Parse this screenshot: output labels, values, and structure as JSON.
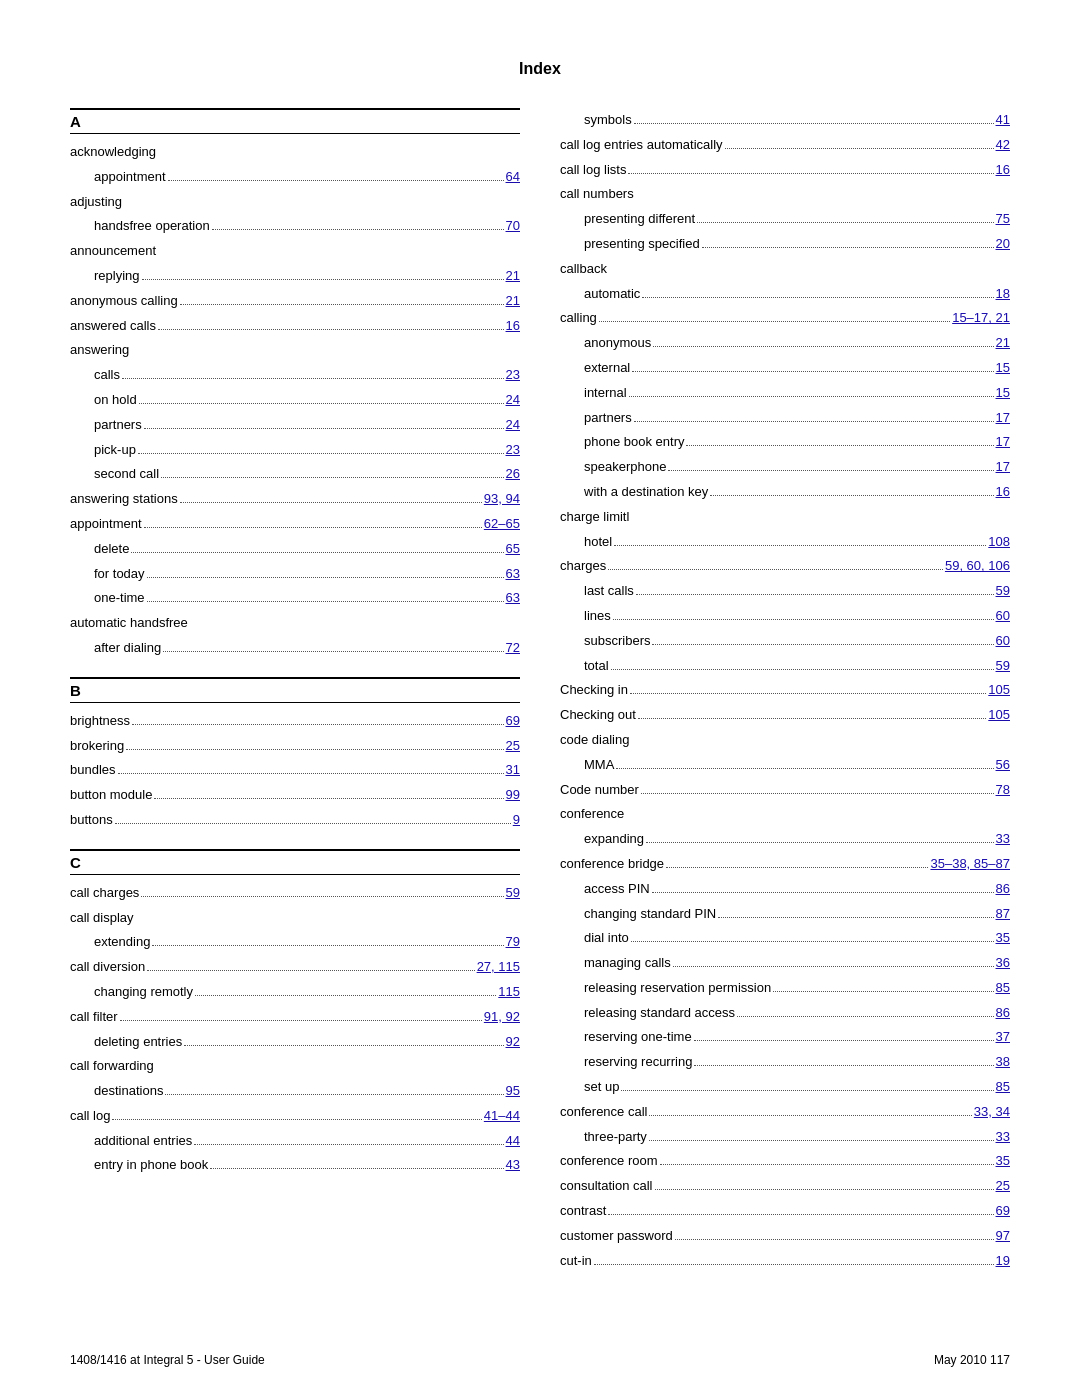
{
  "title": "Index",
  "footer": {
    "left": "1408/1416 at Integral 5 - User Guide",
    "right": "May 2010    117"
  },
  "left_column": {
    "sections": [
      {
        "header": "A",
        "entries": [
          {
            "term": "acknowledging",
            "dots": true,
            "page": ""
          },
          {
            "term": "appointment",
            "indent": 1,
            "dots": true,
            "page": "64"
          },
          {
            "term": "adjusting",
            "dots": true,
            "page": ""
          },
          {
            "term": "handsfree operation",
            "indent": 1,
            "dots": true,
            "page": "70"
          },
          {
            "term": "announcement",
            "dots": true,
            "page": ""
          },
          {
            "term": "replying",
            "indent": 1,
            "dots": true,
            "page": "21"
          },
          {
            "term": "anonymous calling",
            "dots": true,
            "page": "21"
          },
          {
            "term": "answered calls",
            "dots": true,
            "page": "16"
          },
          {
            "term": "answering",
            "dots": true,
            "page": ""
          },
          {
            "term": "calls",
            "indent": 1,
            "dots": true,
            "page": "23"
          },
          {
            "term": "on hold",
            "indent": 1,
            "dots": true,
            "page": "24"
          },
          {
            "term": "partners",
            "indent": 1,
            "dots": true,
            "page": "24"
          },
          {
            "term": "pick-up",
            "indent": 1,
            "dots": true,
            "page": "23"
          },
          {
            "term": "second call",
            "indent": 1,
            "dots": true,
            "page": "26"
          },
          {
            "term": "answering stations",
            "dots": true,
            "page": "93, 94"
          },
          {
            "term": "appointment",
            "dots": true,
            "page": "62–65"
          },
          {
            "term": "delete",
            "indent": 1,
            "dots": true,
            "page": "65"
          },
          {
            "term": "for today",
            "indent": 1,
            "dots": true,
            "page": "63"
          },
          {
            "term": "one-time",
            "indent": 1,
            "dots": true,
            "page": "63"
          },
          {
            "term": "automatic handsfree",
            "dots": true,
            "page": ""
          },
          {
            "term": "after dialing",
            "indent": 1,
            "dots": true,
            "page": "72"
          }
        ]
      },
      {
        "header": "B",
        "entries": [
          {
            "term": "brightness",
            "dots": true,
            "page": "69"
          },
          {
            "term": "brokering",
            "dots": true,
            "page": "25"
          },
          {
            "term": "bundles",
            "dots": true,
            "page": "31"
          },
          {
            "term": "button module",
            "dots": true,
            "page": "99"
          },
          {
            "term": "buttons",
            "dots": true,
            "page": "9"
          }
        ]
      },
      {
        "header": "C",
        "entries": [
          {
            "term": "call charges",
            "dots": true,
            "page": "59"
          },
          {
            "term": "call display",
            "dots": true,
            "page": ""
          },
          {
            "term": "extending",
            "indent": 1,
            "dots": true,
            "page": "79"
          },
          {
            "term": "call diversion",
            "dots": true,
            "page": "27, 115"
          },
          {
            "term": "changing remotly",
            "indent": 1,
            "dots": true,
            "page": "115"
          },
          {
            "term": "call filter",
            "dots": true,
            "page": "91, 92"
          },
          {
            "term": "deleting entries",
            "indent": 1,
            "dots": true,
            "page": "92"
          },
          {
            "term": "call forwarding",
            "dots": true,
            "page": ""
          },
          {
            "term": "destinations",
            "indent": 1,
            "dots": true,
            "page": "95"
          },
          {
            "term": "call log",
            "dots": true,
            "page": "41–44"
          },
          {
            "term": "additional entries",
            "indent": 1,
            "dots": true,
            "page": "44"
          },
          {
            "term": "entry in phone book",
            "indent": 1,
            "dots": true,
            "page": "43"
          }
        ]
      }
    ]
  },
  "right_column": {
    "entries_top": [
      {
        "term": "symbols",
        "indent": 1,
        "dots": true,
        "page": "41"
      },
      {
        "term": "call log entries automatically",
        "dots": true,
        "page": "42"
      },
      {
        "term": "call log lists",
        "dots": true,
        "page": "16"
      },
      {
        "term": "call numbers",
        "dots": true,
        "page": ""
      },
      {
        "term": "presenting different",
        "indent": 1,
        "dots": true,
        "page": "75"
      },
      {
        "term": "presenting specified",
        "indent": 1,
        "dots": true,
        "page": "20"
      },
      {
        "term": "callback",
        "dots": true,
        "page": ""
      },
      {
        "term": "automatic",
        "indent": 1,
        "dots": true,
        "page": "18"
      },
      {
        "term": "calling",
        "dots": true,
        "page": "15–17, 21"
      },
      {
        "term": "anonymous",
        "indent": 1,
        "dots": true,
        "page": "21"
      },
      {
        "term": "external",
        "indent": 1,
        "dots": true,
        "page": "15"
      },
      {
        "term": "internal",
        "indent": 1,
        "dots": true,
        "page": "15"
      },
      {
        "term": "partners",
        "indent": 1,
        "dots": true,
        "page": "17"
      },
      {
        "term": "phone book entry",
        "indent": 1,
        "dots": true,
        "page": "17"
      },
      {
        "term": "speakerphone",
        "indent": 1,
        "dots": true,
        "page": "17"
      },
      {
        "term": "with a destination key",
        "indent": 1,
        "dots": true,
        "page": "16"
      },
      {
        "term": "charge limitl",
        "dots": true,
        "page": ""
      },
      {
        "term": "hotel",
        "indent": 1,
        "dots": true,
        "page": "108"
      },
      {
        "term": "charges",
        "dots": true,
        "page": "59, 60, 106"
      },
      {
        "term": "last calls",
        "indent": 1,
        "dots": true,
        "page": "59"
      },
      {
        "term": "lines",
        "indent": 1,
        "dots": true,
        "page": "60"
      },
      {
        "term": "subscribers",
        "indent": 1,
        "dots": true,
        "page": "60"
      },
      {
        "term": "total",
        "indent": 1,
        "dots": true,
        "page": "59"
      },
      {
        "term": "Checking in",
        "dots": true,
        "page": "105"
      },
      {
        "term": "Checking out",
        "dots": true,
        "page": "105"
      },
      {
        "term": "code dialing",
        "dots": true,
        "page": ""
      },
      {
        "term": "MMA",
        "indent": 1,
        "dots": true,
        "page": "56"
      },
      {
        "term": "Code number",
        "dots": true,
        "page": "78"
      },
      {
        "term": "conference",
        "dots": true,
        "page": ""
      },
      {
        "term": "expanding",
        "indent": 1,
        "dots": true,
        "page": "33"
      },
      {
        "term": "conference bridge",
        "dots": true,
        "page": "35–38, 85–87"
      },
      {
        "term": "access PIN",
        "indent": 1,
        "dots": true,
        "page": "86"
      },
      {
        "term": "changing standard PIN",
        "indent": 1,
        "dots": true,
        "page": "87"
      },
      {
        "term": "dial into",
        "indent": 1,
        "dots": true,
        "page": "35"
      },
      {
        "term": "managing calls",
        "indent": 1,
        "dots": true,
        "page": "36"
      },
      {
        "term": "releasing reservation permission",
        "indent": 1,
        "dots": true,
        "page": "85"
      },
      {
        "term": "releasing standard access",
        "indent": 1,
        "dots": true,
        "page": "86"
      },
      {
        "term": "reserving one-time",
        "indent": 1,
        "dots": true,
        "page": "37"
      },
      {
        "term": "reserving recurring",
        "indent": 1,
        "dots": true,
        "page": "38"
      },
      {
        "term": "set up",
        "indent": 1,
        "dots": true,
        "page": "85"
      },
      {
        "term": "conference call",
        "dots": true,
        "page": "33, 34"
      },
      {
        "term": "three-party",
        "indent": 1,
        "dots": true,
        "page": "33"
      },
      {
        "term": "conference room",
        "dots": true,
        "page": "35"
      },
      {
        "term": "consultation call",
        "dots": true,
        "page": "25"
      },
      {
        "term": "contrast",
        "dots": true,
        "page": "69"
      },
      {
        "term": "customer password",
        "dots": true,
        "page": "97"
      },
      {
        "term": "cut-in",
        "dots": true,
        "page": "19"
      }
    ]
  }
}
